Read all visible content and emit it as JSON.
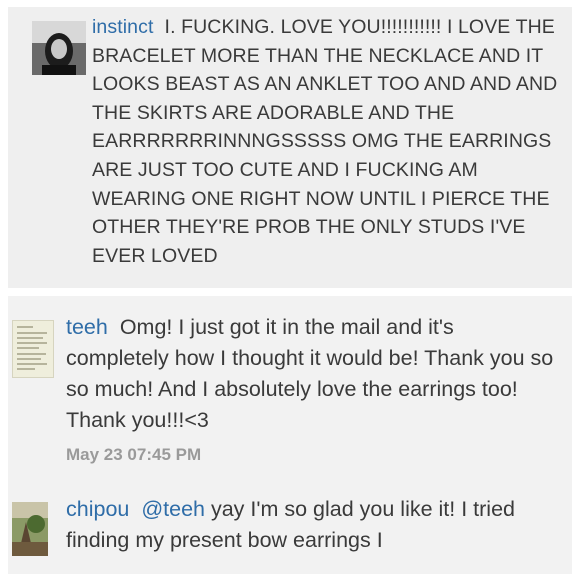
{
  "comments": [
    {
      "username": "instinct",
      "text": "I. FUCKING. LOVE YOU!!!!!!!!!!! I LOVE THE BRACELET MORE THAN THE NECKLACE AND IT LOOKS BEAST AS AN ANKLET TOO AND AND AND THE SKIRTS ARE ADORABLE AND THE EARRRRRRRINNNGSSSSS OMG THE EARRINGS ARE JUST TOO CUTE AND I FUCKING AM WEARING ONE RIGHT NOW UNTIL I PIERCE THE OTHER THEY'RE PROB THE ONLY STUDS I'VE EVER LOVED"
    },
    {
      "username": "teeh",
      "text": "Omg! I just got it in the mail and it's completely how I thought it would be! Thank you so so much! And I absolutely love the earrings too! Thank you!!!<3",
      "timestamp": "May 23 07:45 PM"
    },
    {
      "username": "chipou",
      "mention": "@teeh",
      "text": "yay I'm so glad you like it! I tried finding my present bow earrings I"
    }
  ],
  "colors": {
    "username": "#2f6da8",
    "body_text": "#3a3a3a",
    "timestamp": "#9a9a9a"
  }
}
